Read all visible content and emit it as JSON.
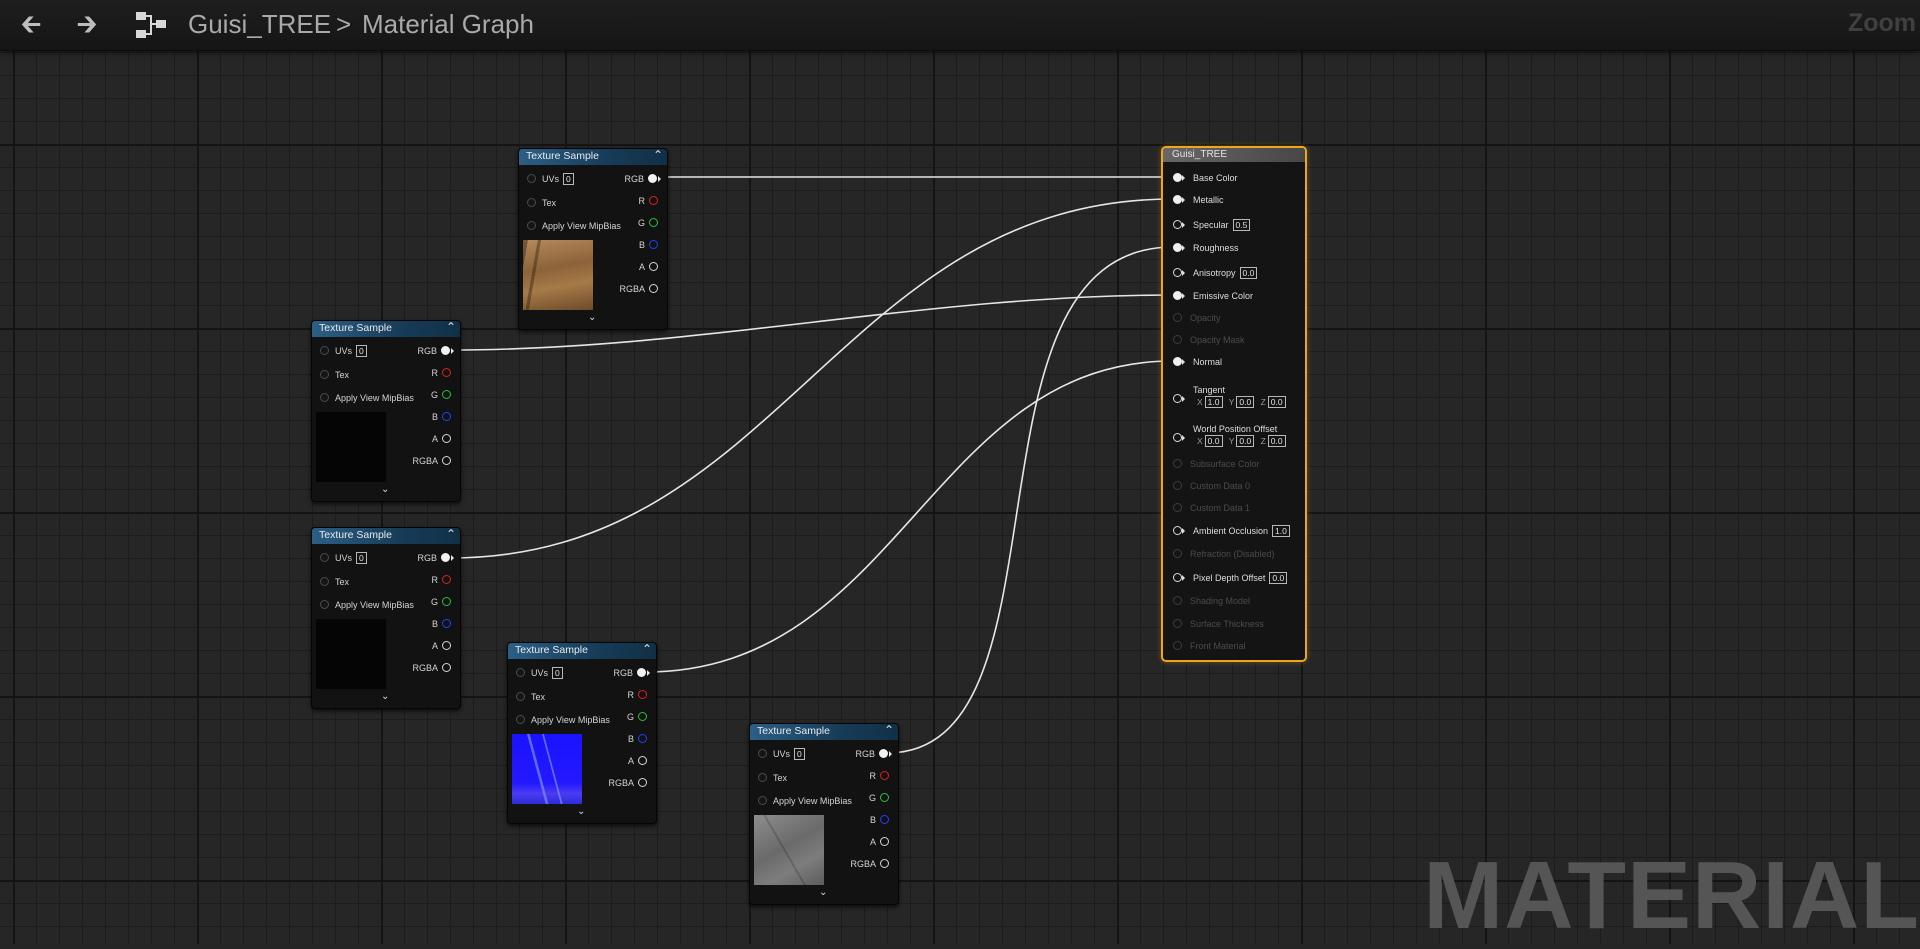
{
  "toolbar": {
    "back_icon": "back-arrow-icon",
    "forward_icon": "forward-arrow-icon",
    "graph_icon": "material-graph-icon",
    "breadcrumb_asset": "Guisi_TREE",
    "breadcrumb_separator": ">",
    "breadcrumb_graph": "Material Graph",
    "zoom_label": "Zoom"
  },
  "texture_node": {
    "title": "Texture Sample",
    "inputs": {
      "uvs": "UVs",
      "uvs_value": "0",
      "tex": "Tex",
      "mipbias": "Apply View MipBias"
    },
    "outputs": {
      "rgb": "RGB",
      "r": "R",
      "g": "G",
      "b": "B",
      "a": "A",
      "rgba": "RGBA"
    }
  },
  "texture_nodes": [
    {
      "id": "tex1",
      "preview": "brown-texture"
    },
    {
      "id": "tex2",
      "preview": "black-texture"
    },
    {
      "id": "tex3",
      "preview": "black-texture"
    },
    {
      "id": "tex4",
      "preview": "blue-normal-texture"
    },
    {
      "id": "tex5",
      "preview": "grey-texture"
    }
  ],
  "output_node": {
    "title": "Guisi_TREE",
    "pins": {
      "base_color": "Base Color",
      "metallic": "Metallic",
      "specular": "Specular",
      "specular_value": "0.5",
      "roughness": "Roughness",
      "anisotropy": "Anisotropy",
      "anisotropy_value": "0.0",
      "emissive": "Emissive Color",
      "opacity": "Opacity",
      "opacity_mask": "Opacity Mask",
      "normal": "Normal",
      "tangent": "Tangent",
      "tangent_x": "1.0",
      "tangent_y": "0.0",
      "tangent_z": "0.0",
      "wpo": "World Position Offset",
      "wpo_x": "0.0",
      "wpo_y": "0.0",
      "wpo_z": "0.0",
      "subsurface": "Subsurface Color",
      "custom0": "Custom Data 0",
      "custom1": "Custom Data 1",
      "ao": "Ambient Occlusion",
      "ao_value": "1.0",
      "refraction": "Refraction (Disabled)",
      "pdo": "Pixel Depth Offset",
      "pdo_value": "0.0",
      "shading_model": "Shading Model",
      "surface_thickness": "Surface Thickness",
      "front_material": "Front Material"
    },
    "axis": {
      "x": "X",
      "y": "Y",
      "z": "Z"
    }
  },
  "connections": [
    {
      "from": "tex1.RGB",
      "to": "Base Color"
    },
    {
      "from": "tex2.RGB",
      "to": "Emissive Color"
    },
    {
      "from": "tex3.RGB",
      "to": "Metallic"
    },
    {
      "from": "tex4.RGB",
      "to": "Normal"
    },
    {
      "from": "tex5.RGB",
      "to": "Roughness"
    }
  ],
  "colors": {
    "selection": "#f0a423",
    "node_header": "#2b5f86",
    "pin_r": "#e02020",
    "pin_g": "#25c43a",
    "pin_b": "#2440ff"
  },
  "watermark": "MATERIAL"
}
